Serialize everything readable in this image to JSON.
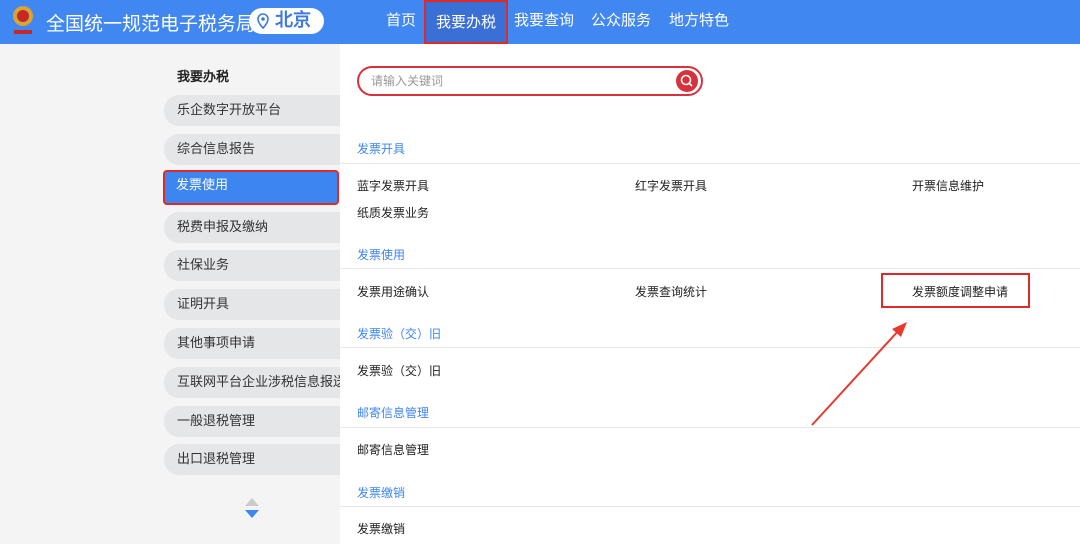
{
  "header": {
    "title": "全国统一规范电子税务局",
    "city": "北京",
    "nav": [
      "首页",
      "我要办税",
      "我要查询",
      "公众服务",
      "地方特色"
    ],
    "active_nav": "我要办税"
  },
  "sidebar": {
    "title": "我要办税",
    "items": [
      "乐企数字开放平台",
      "综合信息报告",
      "发票使用",
      "税费申报及缴纳",
      "社保业务",
      "证明开具",
      "其他事项申请",
      "互联网平台企业涉税信息报送",
      "一般退税管理",
      "出口退税管理"
    ],
    "active": "发票使用"
  },
  "search": {
    "placeholder": "请输入关键词"
  },
  "sections": [
    {
      "title": "发票开具",
      "items": [
        "蓝字发票开具",
        "红字发票开具",
        "开票信息维护",
        "纸质发票业务"
      ]
    },
    {
      "title": "发票使用",
      "items": [
        "发票用途确认",
        "发票查询统计",
        "发票额度调整申请"
      ]
    },
    {
      "title": "发票验（交）旧",
      "items": [
        "发票验（交）旧"
      ]
    },
    {
      "title": "邮寄信息管理",
      "items": [
        "邮寄信息管理"
      ]
    },
    {
      "title": "发票缴销",
      "items": [
        "发票缴销"
      ]
    }
  ],
  "colors": {
    "header": "#4187f2",
    "accent": "#3d86f2",
    "highlight": "#e02a2a"
  }
}
